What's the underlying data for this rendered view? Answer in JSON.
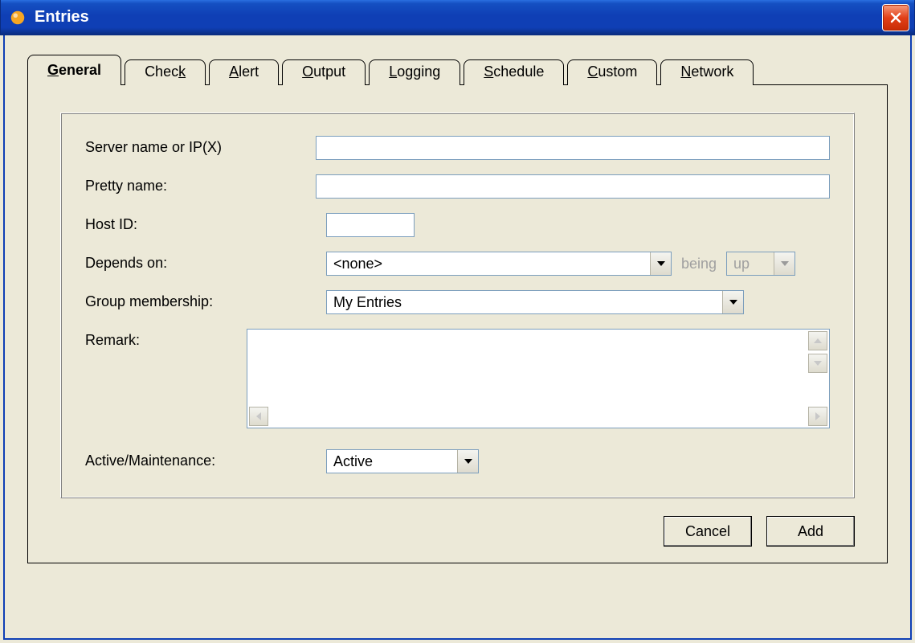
{
  "window": {
    "title": "Entries",
    "icon": "entries-icon"
  },
  "tabs": [
    {
      "label": "General",
      "mn": "G",
      "active": true
    },
    {
      "label": "Check",
      "mn": "k",
      "active": false
    },
    {
      "label": "Alert",
      "mn": "A",
      "active": false
    },
    {
      "label": "Output",
      "mn": "O",
      "active": false
    },
    {
      "label": "Logging",
      "mn": "L",
      "active": false
    },
    {
      "label": "Schedule",
      "mn": "S",
      "active": false
    },
    {
      "label": "Custom",
      "mn": "C",
      "active": false
    },
    {
      "label": "Network",
      "mn": "N",
      "active": false
    }
  ],
  "form": {
    "server_label": "Server name or IP(X)",
    "server_value": "",
    "pretty_label": "Pretty name:",
    "pretty_value": "",
    "hostid_label": "Host ID:",
    "hostid_value": "",
    "depends_label": "Depends on:",
    "depends_value": "<none>",
    "being_text": "being",
    "being_state_value": "up",
    "group_label": "Group membership:",
    "group_value": "My Entries",
    "remark_label": "Remark:",
    "remark_value": "",
    "active_label": "Active/Maintenance:",
    "active_value": "Active"
  },
  "buttons": {
    "cancel": "Cancel",
    "add": "Add"
  }
}
